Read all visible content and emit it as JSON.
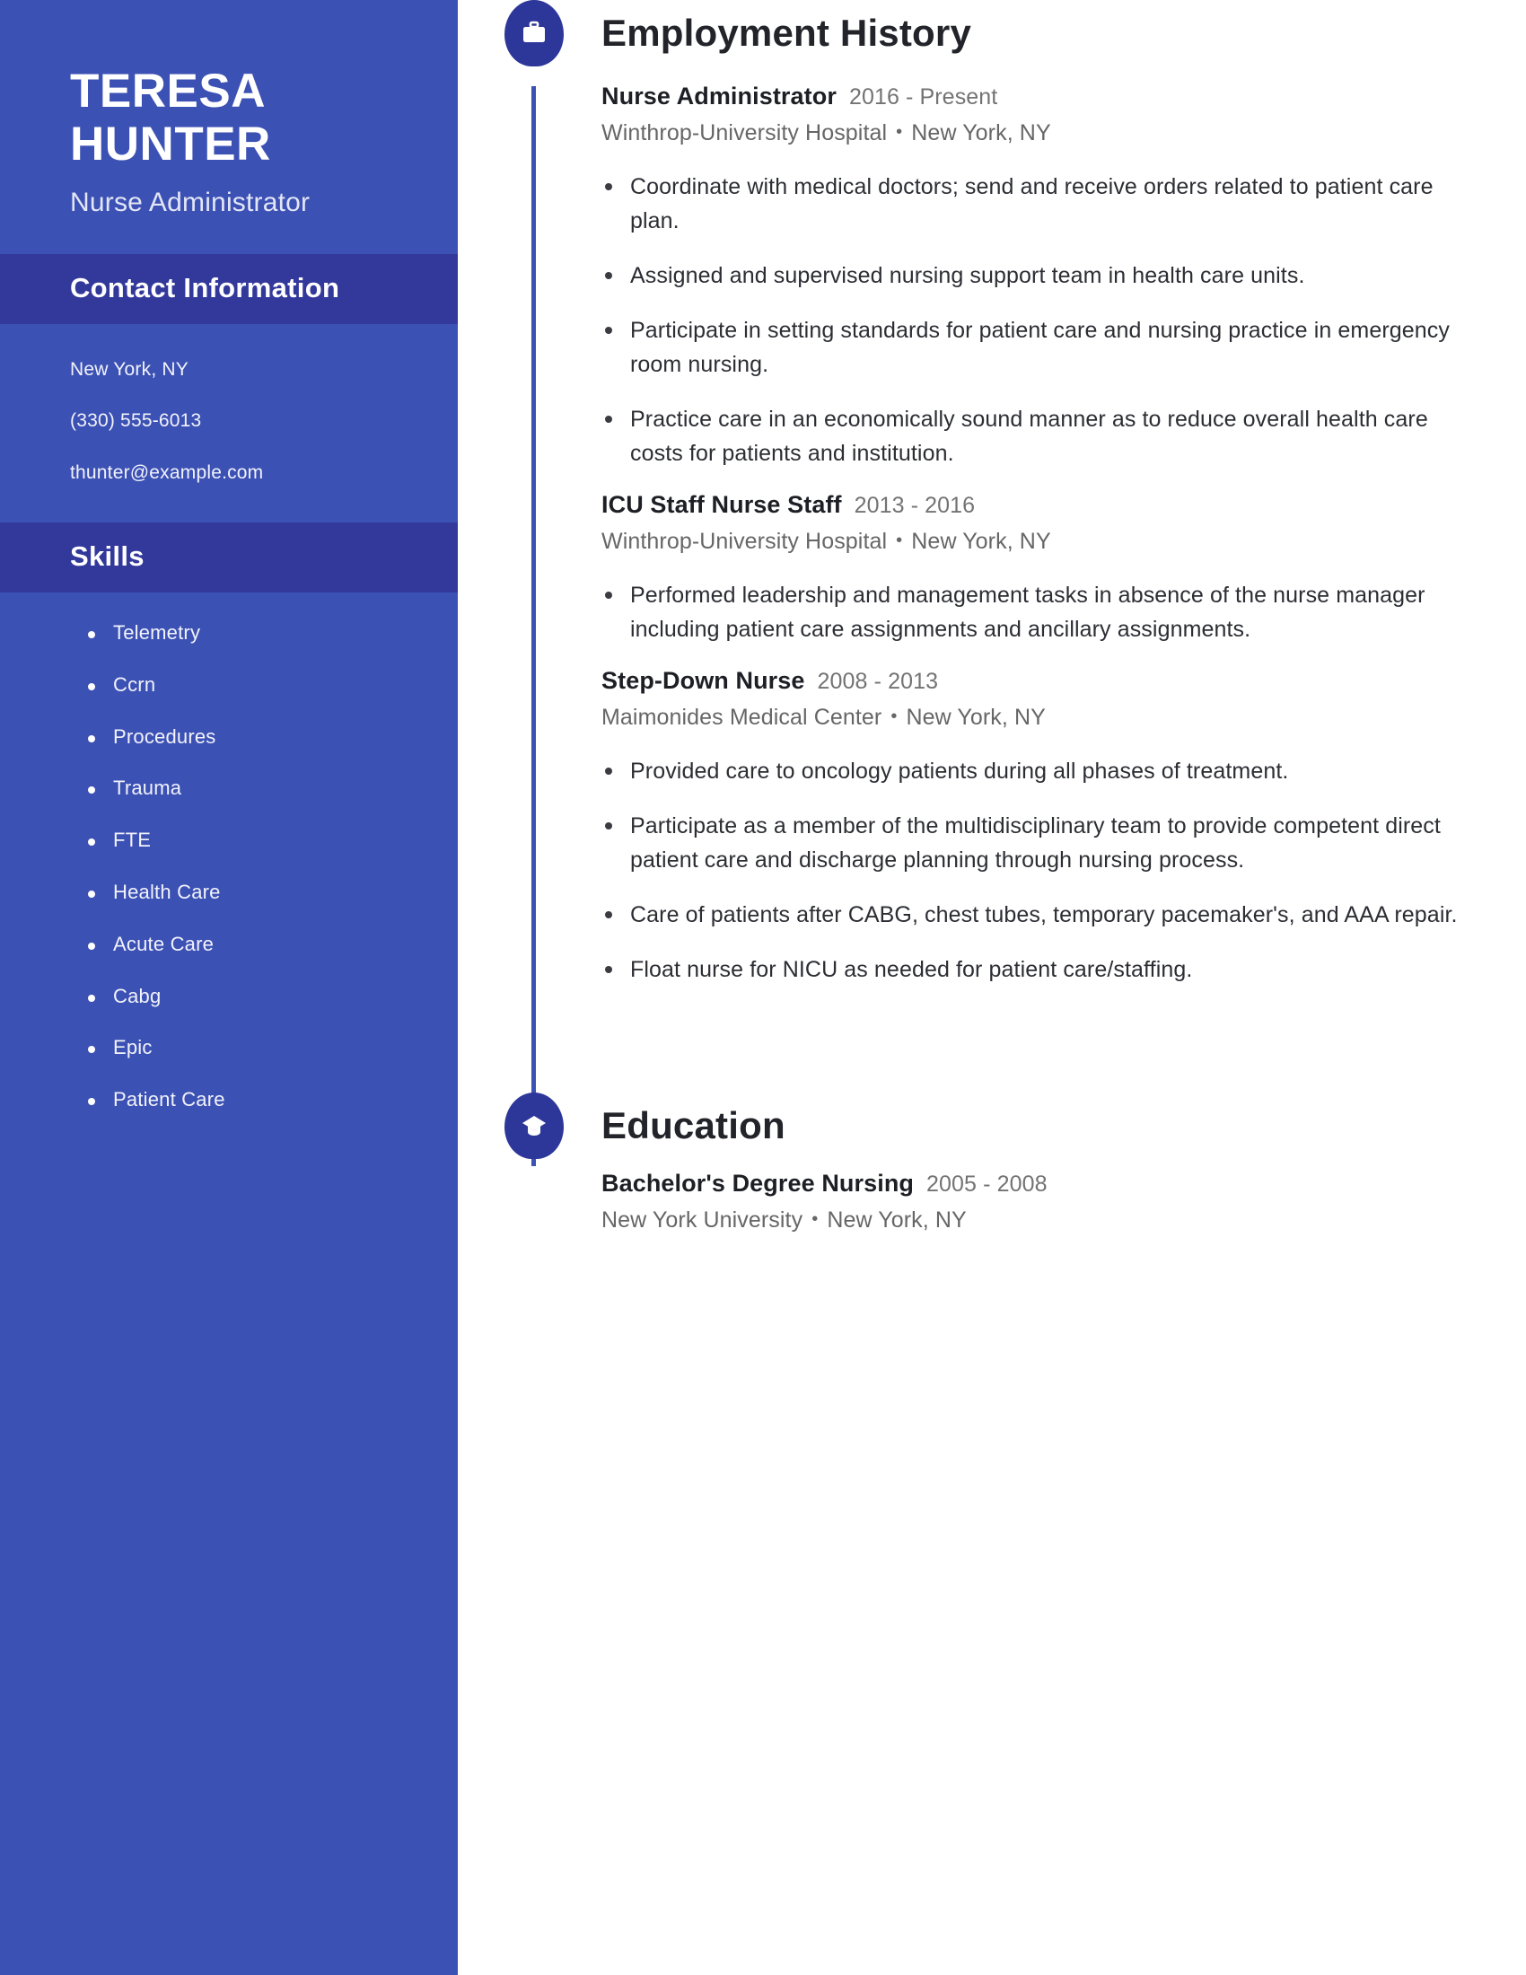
{
  "sidebar": {
    "first_name": "TERESA",
    "last_name": "HUNTER",
    "job_title": "Nurse Administrator",
    "contact": {
      "heading": "Contact Information",
      "location": "New York, NY",
      "phone": "(330) 555-6013",
      "email": "thunter@example.com"
    },
    "skills": {
      "heading": "Skills",
      "items": [
        "Telemetry",
        "Ccrn",
        "Procedures",
        "Trauma",
        "FTE",
        "Health Care",
        "Acute Care",
        "Cabg",
        "Epic",
        "Patient Care"
      ]
    }
  },
  "employment": {
    "heading": "Employment History",
    "icon": "briefcase-icon",
    "entries": [
      {
        "role": "Nurse Administrator",
        "dates": "2016 - Present",
        "company": "Winthrop-University Hospital",
        "location": "New York, NY",
        "bullets": [
          "Coordinate with medical doctors; send and receive orders related to patient care plan.",
          "Assigned and supervised nursing support team in health care units.",
          "Participate in setting standards for patient care and nursing practice in emergency room nursing.",
          "Practice care in an economically sound manner as to reduce overall health care costs for patients and institution."
        ]
      },
      {
        "role": "ICU Staff Nurse Staff",
        "dates": "2013 - 2016",
        "company": "Winthrop-University Hospital",
        "location": "New York, NY",
        "bullets": [
          "Performed leadership and management tasks in absence of the nurse manager including patient care assignments and ancillary assignments."
        ]
      },
      {
        "role": "Step-Down Nurse",
        "dates": "2008 - 2013",
        "company": "Maimonides Medical Center",
        "location": "New York, NY",
        "bullets": [
          "Provided care to oncology patients during all phases of treatment.",
          "Participate as a member of the multidisciplinary team to provide competent direct patient care and discharge planning through nursing process.",
          "Care of patients after CABG, chest tubes, temporary pacemaker's, and AAA repair.",
          "Float nurse for NICU as needed for patient care/staffing."
        ]
      }
    ]
  },
  "education": {
    "heading": "Education",
    "icon": "graduation-cap-icon",
    "entries": [
      {
        "degree": "Bachelor's Degree Nursing",
        "dates": "2005 - 2008",
        "school": "New York University",
        "location": "New York, NY"
      }
    ]
  },
  "separator": "•",
  "colors": {
    "sidebar_blue": "#3c51b4",
    "band_blue": "#33399b",
    "icon_circle": "#2d3799",
    "heading_text": "#22242a",
    "body_text": "#2c2e34",
    "muted_text": "#666666"
  }
}
